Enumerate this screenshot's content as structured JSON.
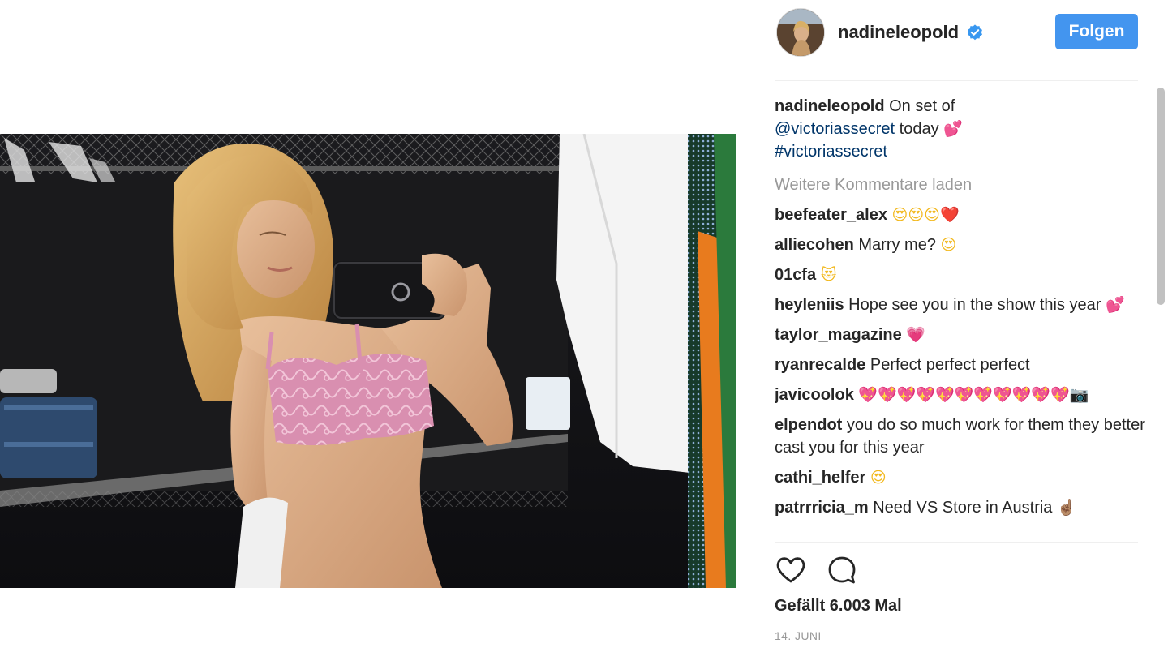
{
  "post": {
    "image_alt": "selfie in dressing room",
    "author": {
      "username": "nadineleopold",
      "verified": true,
      "avatar_icon": "profile-avatar"
    },
    "follow_label": "Folgen",
    "caption": {
      "username": "nadineleopold",
      "text_before": " On set of ",
      "mention": "@victoriassecret",
      "text_after": " today ",
      "emoji": "💕",
      "hashtag": "#victoriassecret"
    },
    "load_more_label": "Weitere Kommentare laden",
    "comments": [
      {
        "username": "beefeater_alex",
        "text": "",
        "emoji": "😍😍😍❤️"
      },
      {
        "username": "alliecohen",
        "text": "Marry me?",
        "emoji": "😍"
      },
      {
        "username": "01cfa",
        "text": "",
        "emoji": "😻"
      },
      {
        "username": "heyleniis",
        "text": "Hope see you in the show this year",
        "emoji": "💕"
      },
      {
        "username": "taylor_magazine",
        "text": "",
        "emoji": "💗"
      },
      {
        "username": "ryanrecalde",
        "text": "Perfect perfect perfect",
        "emoji": ""
      },
      {
        "username": "javicoolok",
        "text": "",
        "emoji": "💖💖💖💖💖💖💖💖💖💖💖📷"
      },
      {
        "username": "elpendot",
        "text": "you do so much work for them they better cast you for this year",
        "emoji": ""
      },
      {
        "username": "cathi_helfer",
        "text": "",
        "emoji": "😍"
      },
      {
        "username": "patrrricia_m",
        "text": "Need VS Store in Austria",
        "emoji": "☝🏽"
      }
    ],
    "likes_label": "Gefällt 6.003 Mal",
    "date": "14. JUNI",
    "colors": {
      "follow_button": "#4395ef",
      "link": "#003569",
      "muted": "#999999",
      "verified_badge": "#3897f0"
    },
    "icons": [
      "heart-icon",
      "comment-icon",
      "verified-badge-icon"
    ]
  }
}
